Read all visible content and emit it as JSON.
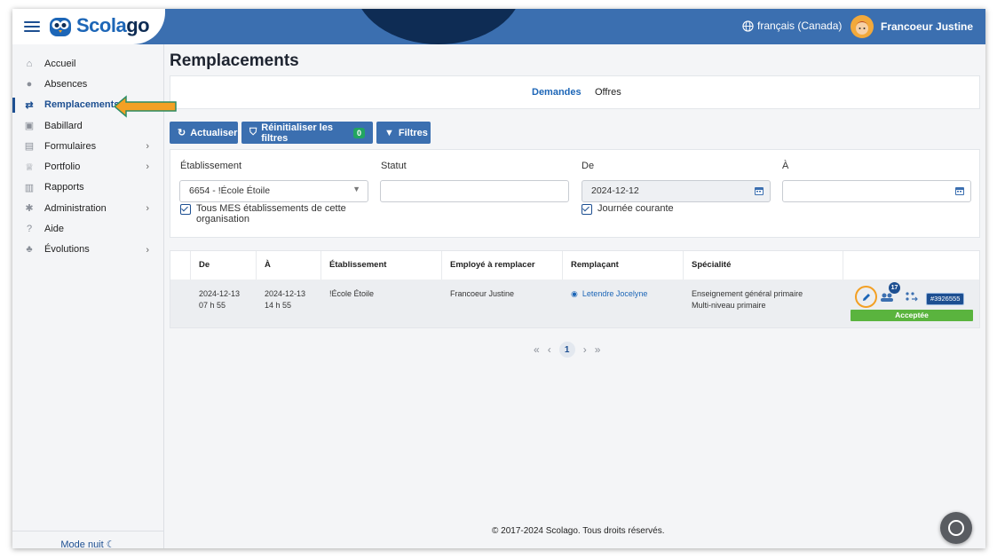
{
  "app": {
    "name_part1": "Scola",
    "name_part2": "go"
  },
  "header": {
    "language": "français (Canada)",
    "user_name": "Francoeur Justine"
  },
  "sidebar": {
    "items": [
      {
        "label": "Accueil",
        "icon": "home-icon",
        "active": false,
        "has_chevron": false
      },
      {
        "label": "Absences",
        "icon": "user-clock-icon",
        "active": false,
        "has_chevron": false
      },
      {
        "label": "Remplacements",
        "icon": "swap-icon",
        "active": true,
        "has_chevron": false
      },
      {
        "label": "Babillard",
        "icon": "board-icon",
        "active": false,
        "has_chevron": false
      },
      {
        "label": "Formulaires",
        "icon": "document-icon",
        "active": false,
        "has_chevron": true
      },
      {
        "label": "Portfolio",
        "icon": "trophy-icon",
        "active": false,
        "has_chevron": true
      },
      {
        "label": "Rapports",
        "icon": "report-icon",
        "active": false,
        "has_chevron": false
      },
      {
        "label": "Administration",
        "icon": "gear-icon",
        "active": false,
        "has_chevron": true
      },
      {
        "label": "Aide",
        "icon": "question-icon",
        "active": false,
        "has_chevron": false
      },
      {
        "label": "Évolutions",
        "icon": "sprout-icon",
        "active": false,
        "has_chevron": true
      }
    ],
    "night_mode": "Mode nuit"
  },
  "page": {
    "title": "Remplacements"
  },
  "tabs": [
    {
      "label": "Demandes",
      "active": true
    },
    {
      "label": "Offres",
      "active": false
    }
  ],
  "toolbar": {
    "refresh_label": "Actualiser",
    "reset_label": "Réinitialiser les filtres",
    "reset_count": "0",
    "filters_label": "Filtres"
  },
  "filters": {
    "etablissement_label": "Établissement",
    "etablissement_value": "6654 - !École Étoile",
    "all_establishments_check": "Tous MES établissements de cette organisation",
    "statut_label": "Statut",
    "statut_value": "",
    "de_label": "De",
    "de_value": "2024-12-12",
    "current_day_check": "Journée courante",
    "a_label": "À",
    "a_value": ""
  },
  "table": {
    "headers": [
      "De",
      "À",
      "Établissement",
      "Employé à remplacer",
      "Remplaçant",
      "Spécialité"
    ],
    "rows": [
      {
        "de_date": "2024-12-13",
        "de_time": "07 h 55",
        "a_date": "2024-12-13",
        "a_time": "14 h 55",
        "etablissement": "!École Étoile",
        "employe": "Francoeur Justine",
        "remplacant": "Letendre Jocelyne",
        "specialite_1": "Enseignement général primaire",
        "specialite_2": "Multi-niveau primaire",
        "notification_count": "17",
        "id": "#3926555",
        "status": "Acceptée",
        "status_color": "#5ab43e"
      }
    ]
  },
  "pagination": {
    "current_page": "1"
  },
  "footer": {
    "copyright": "© 2017-2024 Scolago. Tous droits réservés."
  },
  "colors": {
    "primary": "#3b6fb0",
    "navy": "#0e2c54",
    "accent_orange": "#f3a024",
    "success": "#5ab43e"
  }
}
